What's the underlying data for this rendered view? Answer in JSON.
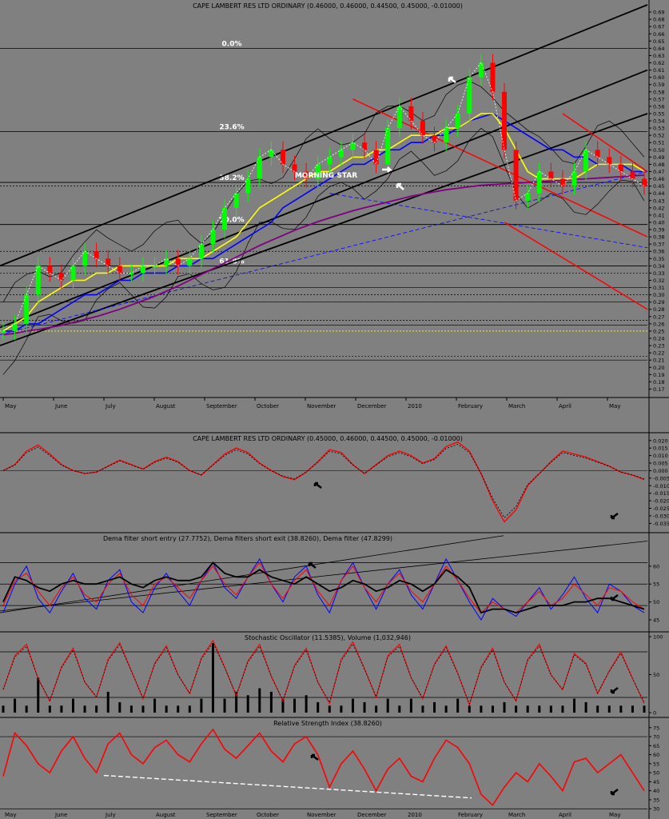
{
  "chart_data": [
    {
      "id": "price",
      "type": "candlestick",
      "title": "CAPE LAMBERT RES LTD ORDINARY (0.46000, 0.46000, 0.44500, 0.45000, -0.01000)",
      "ylim": [
        0.165,
        0.7
      ],
      "y_ticks": [
        "0.69",
        "0.68",
        "0.67",
        "0.66",
        "0.65",
        "0.64",
        "0.63",
        "0.62",
        "0.61",
        "0.60",
        "0.59",
        "0.58",
        "0.57",
        "0.56",
        "0.55",
        "0.54",
        "0.53",
        "0.52",
        "0.51",
        "0.50",
        "0.49",
        "0.48",
        "0.47",
        "0.46",
        "0.45",
        "0.44",
        "0.43",
        "0.42",
        "0.41",
        "0.40",
        "0.39",
        "0.38",
        "0.37",
        "0.36",
        "0.35",
        "0.34",
        "0.33",
        "0.32",
        "0.31",
        "0.30",
        "0.29",
        "0.28",
        "0.27",
        "0.26",
        "0.25",
        "0.24",
        "0.23",
        "0.22",
        "0.21",
        "0.20",
        "0.19",
        "0.18",
        "0.17"
      ],
      "x_labels": [
        "May",
        "June",
        "July",
        "August",
        "September",
        "October",
        "November",
        "December",
        "2010",
        "February",
        "March",
        "April",
        "May"
      ],
      "fib_levels": [
        {
          "label": "0.0%",
          "value": 0.64
        },
        {
          "label": "23.6%",
          "value": 0.525
        },
        {
          "label": "38.2%",
          "value": 0.455
        },
        {
          "label": "50.0%",
          "value": 0.397
        },
        {
          "label": "61.8%",
          "value": 0.34
        }
      ],
      "annotation": "MORNING STAR",
      "close": [
        0.25,
        0.26,
        0.3,
        0.34,
        0.33,
        0.32,
        0.34,
        0.36,
        0.35,
        0.34,
        0.33,
        0.33,
        0.34,
        0.34,
        0.35,
        0.34,
        0.35,
        0.37,
        0.39,
        0.42,
        0.44,
        0.46,
        0.49,
        0.5,
        0.48,
        0.47,
        0.46,
        0.48,
        0.49,
        0.5,
        0.51,
        0.5,
        0.48,
        0.53,
        0.56,
        0.54,
        0.52,
        0.51,
        0.53,
        0.55,
        0.6,
        0.62,
        0.58,
        0.5,
        0.43,
        0.44,
        0.47,
        0.46,
        0.45,
        0.47,
        0.5,
        0.49,
        0.48,
        0.47,
        0.46,
        0.45
      ],
      "sma_yellow": [
        0.25,
        0.26,
        0.27,
        0.29,
        0.3,
        0.31,
        0.32,
        0.32,
        0.33,
        0.33,
        0.34,
        0.34,
        0.34,
        0.34,
        0.34,
        0.35,
        0.35,
        0.35,
        0.36,
        0.37,
        0.38,
        0.4,
        0.42,
        0.43,
        0.44,
        0.45,
        0.46,
        0.47,
        0.47,
        0.48,
        0.49,
        0.49,
        0.5,
        0.5,
        0.51,
        0.52,
        0.52,
        0.52,
        0.53,
        0.53,
        0.54,
        0.55,
        0.55,
        0.53,
        0.5,
        0.47,
        0.46,
        0.46,
        0.46,
        0.46,
        0.47,
        0.48,
        0.48,
        0.48,
        0.48,
        0.47
      ],
      "sma_blue": [
        0.25,
        0.25,
        0.26,
        0.26,
        0.27,
        0.28,
        0.29,
        0.3,
        0.3,
        0.31,
        0.32,
        0.32,
        0.33,
        0.33,
        0.33,
        0.34,
        0.34,
        0.35,
        0.35,
        0.36,
        0.37,
        0.38,
        0.39,
        0.4,
        0.42,
        0.43,
        0.44,
        0.45,
        0.46,
        0.47,
        0.48,
        0.48,
        0.49,
        0.5,
        0.5,
        0.51,
        0.51,
        0.52,
        0.52,
        0.53,
        0.54,
        0.545,
        0.55,
        0.54,
        0.53,
        0.52,
        0.51,
        0.5,
        0.5,
        0.49,
        0.49,
        0.48,
        0.48,
        0.48,
        0.47,
        0.47
      ],
      "sma_purple": [
        0.245,
        0.247,
        0.25,
        0.252,
        0.255,
        0.258,
        0.262,
        0.266,
        0.27,
        0.275,
        0.28,
        0.286,
        0.292,
        0.298,
        0.305,
        0.312,
        0.32,
        0.328,
        0.336,
        0.344,
        0.352,
        0.36,
        0.368,
        0.375,
        0.382,
        0.389,
        0.395,
        0.401,
        0.406,
        0.411,
        0.416,
        0.42,
        0.424,
        0.428,
        0.432,
        0.436,
        0.439,
        0.442,
        0.445,
        0.447,
        0.449,
        0.451,
        0.452,
        0.453,
        0.454,
        0.455,
        0.456,
        0.457,
        0.458,
        0.459,
        0.46,
        0.461,
        0.462,
        0.463,
        0.464,
        0.465
      ]
    },
    {
      "id": "osc",
      "type": "line",
      "title": "CAPE LAMBERT RES LTD ORDINARY (0.45000, 0.46000, 0.44500, 0.45000, -0.01000)",
      "ylim": [
        -0.038,
        0.022
      ],
      "y_ticks": [
        "0.020",
        "0.015",
        "0.010",
        "0.005",
        "0.000",
        "-0.005",
        "-0.010",
        "-0.015",
        "-0.020",
        "-0.025",
        "-0.030",
        "-0.035"
      ],
      "values": [
        0.0,
        0.004,
        0.013,
        0.017,
        0.011,
        0.004,
        0.0,
        -0.002,
        -0.001,
        0.003,
        0.007,
        0.004,
        0.001,
        0.006,
        0.009,
        0.006,
        0.0,
        -0.003,
        0.004,
        0.011,
        0.015,
        0.012,
        0.005,
        0.0,
        -0.004,
        -0.006,
        -0.001,
        0.006,
        0.014,
        0.012,
        0.004,
        -0.002,
        0.004,
        0.01,
        0.013,
        0.01,
        0.005,
        0.008,
        0.016,
        0.019,
        0.013,
        -0.002,
        -0.02,
        -0.034,
        -0.026,
        -0.01,
        -0.002,
        0.006,
        0.013,
        0.011,
        0.009,
        0.006,
        0.003,
        -0.001,
        -0.003,
        -0.006
      ]
    },
    {
      "id": "dema",
      "type": "line",
      "title": "Dema filter short entry (27.7752), Dema filters short exit (38.8260), Dema filter (47.8299)",
      "ylim": [
        43,
        68
      ],
      "y_ticks": [
        "60",
        "55",
        "50",
        "45"
      ],
      "series": [
        {
          "color": "#0000ff",
          "values": [
            47,
            55,
            60,
            51,
            47,
            53,
            58,
            51,
            48,
            56,
            59,
            50,
            47,
            54,
            58,
            53,
            49,
            56,
            61,
            54,
            51,
            57,
            62,
            55,
            50,
            57,
            60,
            52,
            47,
            56,
            61,
            54,
            48,
            55,
            59,
            52,
            48,
            55,
            62,
            56,
            50,
            45,
            51,
            48,
            46,
            50,
            54,
            48,
            52,
            57,
            51,
            47,
            55,
            53,
            49,
            47
          ]
        },
        {
          "color": "#ff0000",
          "values": [
            49,
            56,
            58,
            53,
            49,
            54,
            57,
            52,
            50,
            55,
            58,
            52,
            49,
            55,
            57,
            54,
            51,
            56,
            60,
            55,
            52,
            57,
            61,
            55,
            51,
            56,
            59,
            53,
            49,
            56,
            60,
            54,
            50,
            55,
            58,
            53,
            50,
            55,
            60,
            56,
            51,
            47,
            50,
            48,
            47,
            50,
            53,
            49,
            51,
            55,
            52,
            49,
            54,
            53,
            50,
            48
          ]
        },
        {
          "color": "#000000",
          "values": [
            50,
            57,
            56,
            54,
            53,
            55,
            56,
            55,
            55,
            56,
            57,
            55,
            54,
            56,
            57,
            56,
            56,
            57,
            61,
            58,
            57,
            57,
            59,
            57,
            56,
            55,
            57,
            55,
            53,
            54,
            56,
            55,
            53,
            54,
            56,
            55,
            53,
            55,
            59,
            57,
            54,
            47,
            48,
            48,
            47,
            48,
            49,
            49,
            49,
            50,
            50,
            51,
            51,
            50,
            49,
            48
          ]
        }
      ]
    },
    {
      "id": "stoch",
      "type": "line",
      "title": "Stochastic Oscillator (11.5385), Volume (1,032,946)",
      "ylim": [
        0,
        100
      ],
      "y_ticks": [
        "100",
        "50",
        "0"
      ],
      "values": [
        30,
        75,
        90,
        45,
        15,
        60,
        85,
        40,
        20,
        70,
        92,
        55,
        18,
        65,
        88,
        50,
        25,
        72,
        95,
        60,
        22,
        68,
        90,
        48,
        15,
        62,
        85,
        40,
        12,
        70,
        93,
        58,
        20,
        75,
        90,
        46,
        18,
        64,
        88,
        52,
        10,
        60,
        85,
        40,
        15,
        70,
        90,
        50,
        30,
        78,
        65,
        25,
        55,
        80,
        45,
        12
      ],
      "volume": [
        0.1,
        0.2,
        0.1,
        0.5,
        0.1,
        0.1,
        0.2,
        0.1,
        0.1,
        0.3,
        0.15,
        0.1,
        0.1,
        0.2,
        0.1,
        0.1,
        0.1,
        0.2,
        1.0,
        0.2,
        0.3,
        0.25,
        0.35,
        0.3,
        0.2,
        0.2,
        0.25,
        0.15,
        0.1,
        0.1,
        0.2,
        0.15,
        0.1,
        0.2,
        0.1,
        0.2,
        0.1,
        0.15,
        0.1,
        0.2,
        0.1,
        0.1,
        0.1,
        0.15,
        0.1,
        0.1,
        0.1,
        0.1,
        0.1,
        0.2,
        0.15,
        0.1,
        0.1,
        0.1,
        0.1,
        0.1
      ]
    },
    {
      "id": "rsi",
      "type": "line",
      "title": "Relative Strength Index (38.8260)",
      "ylim": [
        27,
        78
      ],
      "y_ticks": [
        "75",
        "70",
        "65",
        "60",
        "55",
        "50",
        "45",
        "40",
        "35",
        "30"
      ],
      "values": [
        48,
        72,
        65,
        55,
        50,
        62,
        70,
        58,
        50,
        66,
        72,
        60,
        55,
        64,
        68,
        60,
        56,
        66,
        74,
        63,
        58,
        65,
        72,
        62,
        56,
        66,
        70,
        60,
        42,
        55,
        62,
        52,
        40,
        52,
        58,
        48,
        45,
        58,
        68,
        64,
        55,
        38,
        32,
        42,
        50,
        45,
        55,
        48,
        40,
        56,
        58,
        50,
        55,
        60,
        50,
        40
      ]
    }
  ]
}
